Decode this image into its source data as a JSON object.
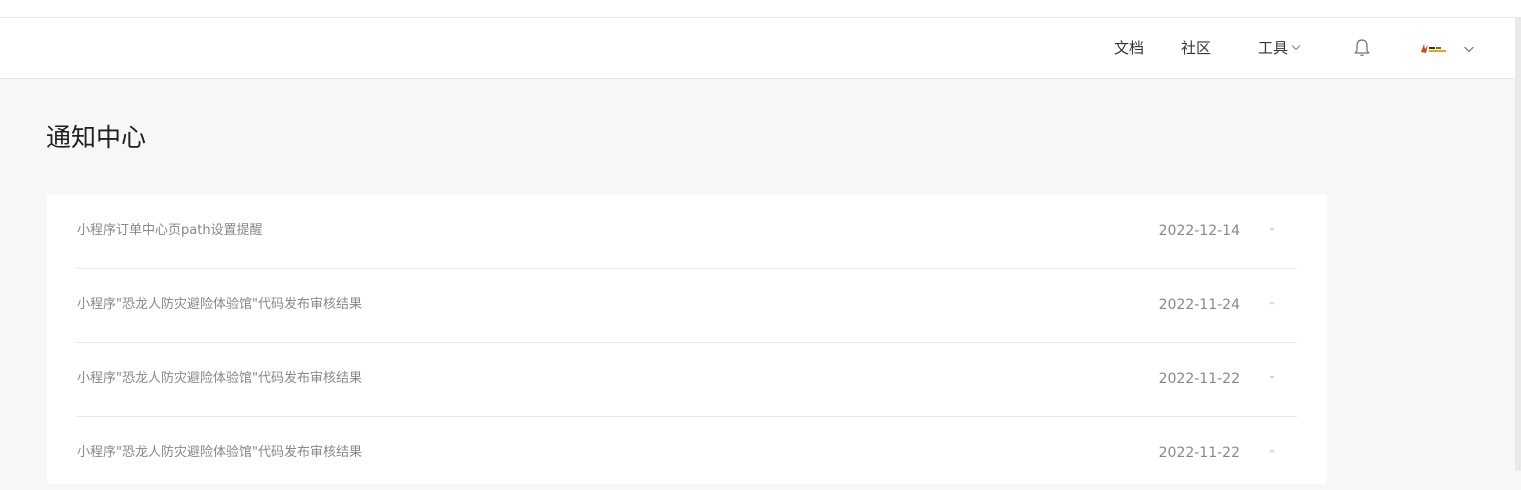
{
  "header": {
    "nav": {
      "docs": "文档",
      "community": "社区",
      "tools": "工具"
    },
    "icons": {
      "bell": "bell-icon",
      "avatar": "avatar",
      "chevron": "chevron-down-icon"
    }
  },
  "page": {
    "title": "通知中心"
  },
  "notifications": [
    {
      "title": "小程序订单中心页path设置提醒",
      "date": "2022-12-14"
    },
    {
      "title": "小程序\"恐龙人防灾避险体验馆\"代码发布审核结果",
      "date": "2022-11-24"
    },
    {
      "title": "小程序\"恐龙人防灾避险体验馆\"代码发布审核结果",
      "date": "2022-11-22"
    },
    {
      "title": "小程序\"恐龙人防灾避险体验馆\"代码发布审核结果",
      "date": "2022-11-22"
    }
  ],
  "colors": {
    "page_bg": "#f6f7f9",
    "card_bg": "#ffffff",
    "muted_text": "#888888",
    "divider": "#e7e7e7"
  }
}
